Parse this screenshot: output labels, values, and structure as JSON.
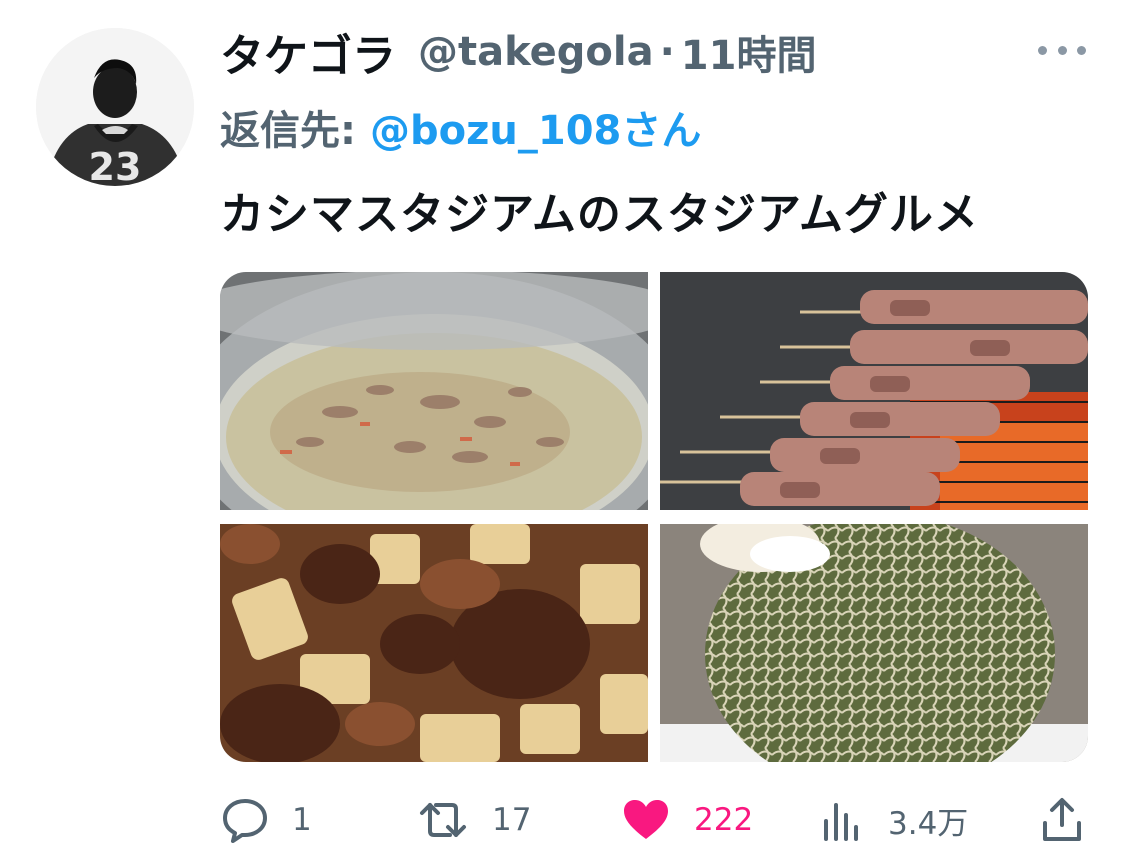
{
  "tweet": {
    "display_name": "タケゴラ",
    "handle": "@takegola",
    "separator": "·",
    "time_ago": "11時間",
    "reply_label": "返信先:",
    "reply_to": "@bozu_108さん",
    "text": "カシマスタジアムのスタジアムグルメ",
    "avatar_jersey_number": "23"
  },
  "actions": {
    "reply_count": "1",
    "retweet_count": "17",
    "like_count": "222",
    "views_count": "3.4万"
  },
  "icons": {
    "more": "more-dots-icon",
    "reply": "speech-bubble-icon",
    "retweet": "retweet-icon",
    "like": "heart-icon",
    "views": "bar-chart-icon",
    "share": "share-upload-icon"
  },
  "colors": {
    "secondary_text": "#536471",
    "link": "#1d9bf0",
    "like_active": "#f91880"
  }
}
